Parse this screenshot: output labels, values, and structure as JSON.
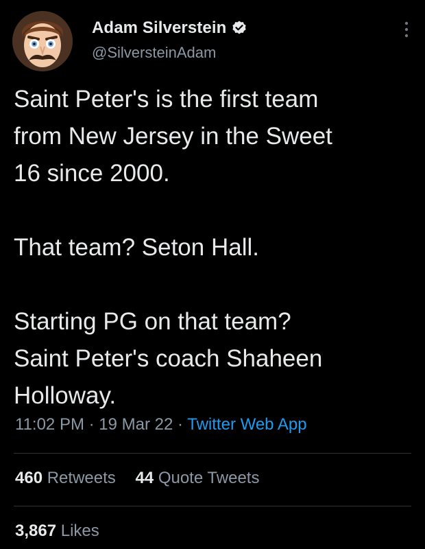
{
  "author": {
    "name": "Adam Silverstein",
    "handle": "@SilversteinAdam",
    "verified": true,
    "avatar_icon": "cartoon-mustache-man-avatar"
  },
  "tweet": {
    "paragraphs": [
      "Saint Peter's is the first team\nfrom New Jersey in the Sweet\n16 since 2000.",
      "That team? Seton Hall.",
      "Starting PG on that team?\nSaint Peter's coach Shaheen\nHolloway."
    ],
    "time": "11:02 PM",
    "date": "19 Mar 22",
    "separator": "·",
    "source": "Twitter Web App"
  },
  "stats": {
    "retweets_count": "460",
    "retweets_label": "Retweets",
    "quotes_count": "44",
    "quotes_label": "Quote Tweets",
    "likes_count": "3,867",
    "likes_label": "Likes"
  },
  "colors": {
    "background": "#000000",
    "text": "#e7e9ea",
    "secondary": "#8b98a5",
    "link": "#1d9bf0",
    "divider": "#2f3336"
  }
}
